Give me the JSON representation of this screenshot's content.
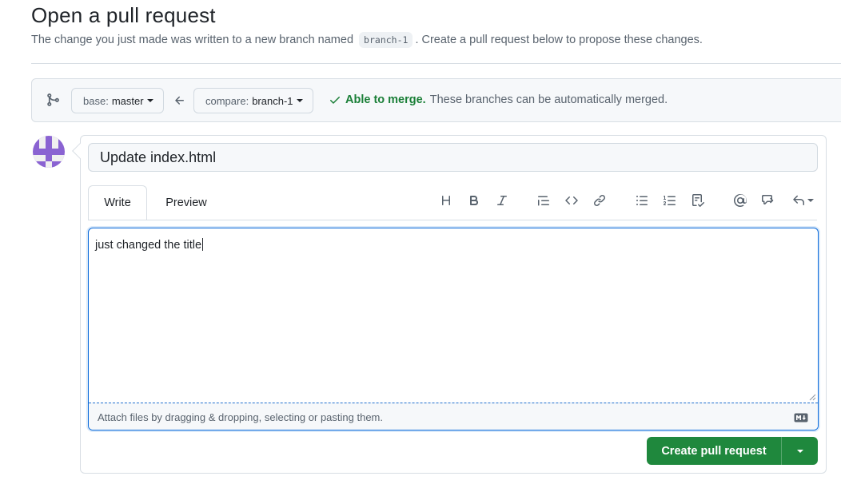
{
  "header": {
    "title": "Open a pull request",
    "subtitle_before": "The change you just made was written to a new branch named",
    "branch_code": "branch-1",
    "subtitle_after": ". Create a pull request below to propose these changes."
  },
  "compare": {
    "base_prefix": "base:",
    "base_value": "master",
    "compare_prefix": "compare:",
    "compare_value": "branch-1",
    "merge_ok": "Able to merge.",
    "merge_desc": "These branches can be automatically merged."
  },
  "form": {
    "title_value": "Update index.html",
    "tabs": [
      "Write",
      "Preview"
    ],
    "body_text": "just changed the title",
    "attach_hint": "Attach files by dragging & dropping, selecting or pasting them.",
    "submit_label": "Create pull request"
  },
  "toolbar": [
    "heading-icon",
    "bold-icon",
    "italic-icon",
    "quote-icon",
    "code-icon",
    "link-icon",
    "unordered-list-icon",
    "ordered-list-icon",
    "tasklist-icon",
    "mention-icon",
    "cross-reference-icon",
    "reply-icon"
  ],
  "colors": {
    "accent": "#0969da",
    "success": "#1a7f37",
    "button_green": "#1f883d",
    "avatar": "#8a63d2"
  }
}
